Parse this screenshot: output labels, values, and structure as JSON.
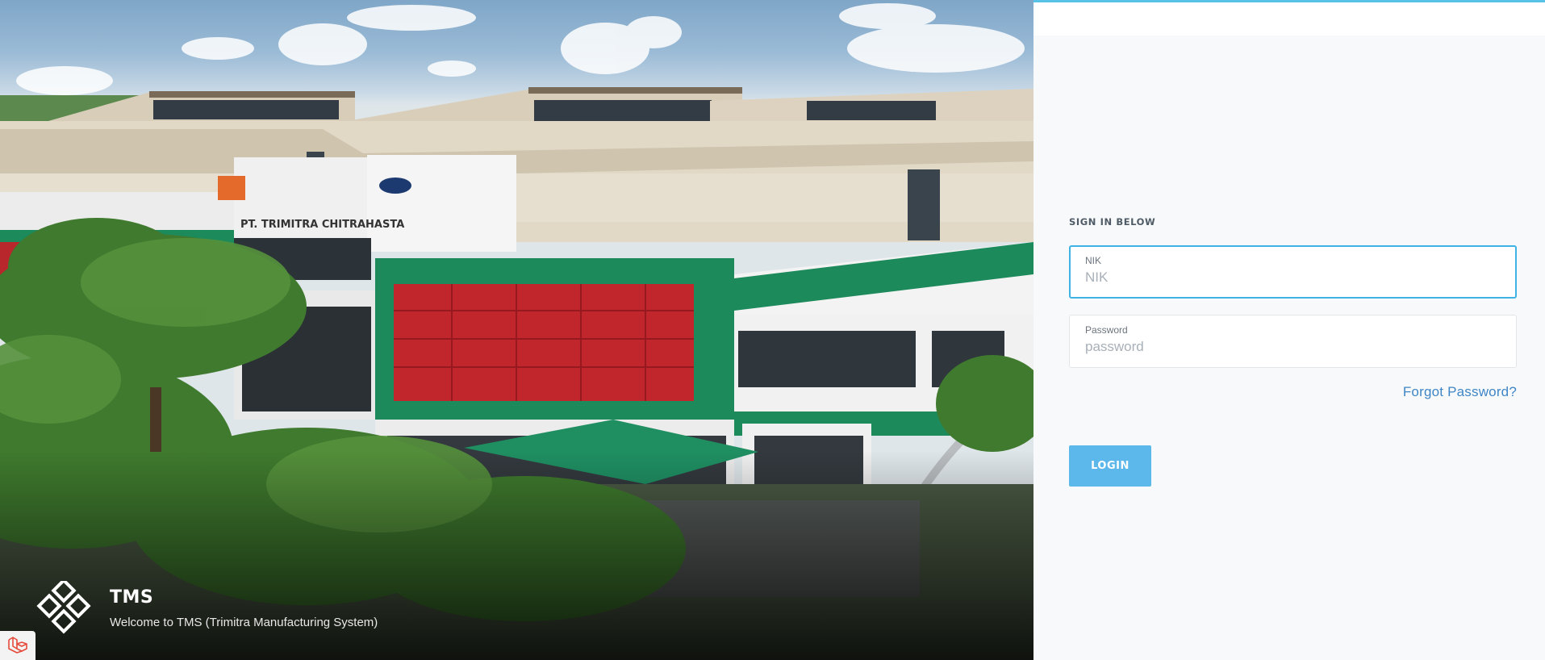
{
  "brand": {
    "title": "TMS",
    "subtitle": "Welcome to TMS (Trimitra Manufacturing System)",
    "building_sign": "PT. TRIMITRA CHITRAHASTA"
  },
  "form": {
    "heading": "SIGN IN BELOW",
    "nik": {
      "label": "NIK",
      "placeholder": "NIK",
      "value": ""
    },
    "password": {
      "label": "Password",
      "placeholder": "password",
      "value": ""
    },
    "forgot_label": "Forgot Password?",
    "login_label": "LOGIN"
  },
  "colors": {
    "accent": "#3fb3e3",
    "button": "#5cb7ea",
    "link": "#3f86c6",
    "facade_green": "#1f8a5e",
    "facade_red": "#c0262c"
  },
  "icons": {
    "logo": "tms-diamonds-logo-icon",
    "corner": "laravel-icon"
  }
}
